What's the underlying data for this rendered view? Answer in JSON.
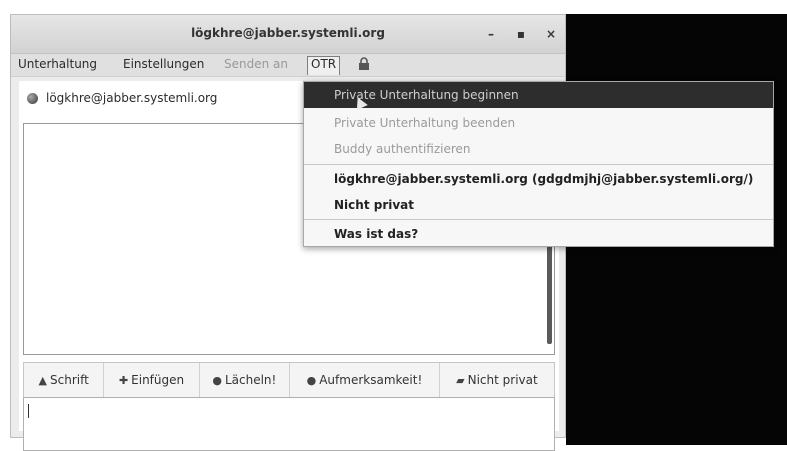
{
  "window": {
    "title": "lögkhre@jabber.systemli.org",
    "minimize_glyph": "–",
    "maximize_glyph": "▪",
    "close_glyph": "×"
  },
  "menubar": {
    "items": [
      "Unterhaltung",
      "Einstellungen",
      "Senden an",
      "OTR"
    ],
    "extra_icon": "lock-icon"
  },
  "contact": {
    "name": "lögkhre@jabber.systemli.org",
    "status_icon": "status-dot-icon"
  },
  "toolbar": {
    "buttons": [
      {
        "label": "Schrift",
        "icon": "font-icon"
      },
      {
        "label": "Einfügen",
        "icon": "insert-icon"
      },
      {
        "label": "Lächeln!",
        "icon": "smiley-icon"
      },
      {
        "label": "Aufmerksamkeit!",
        "icon": "attention-icon"
      },
      {
        "label": "Nicht privat",
        "icon": "unlocked-icon"
      }
    ]
  },
  "otr_menu": {
    "items": [
      {
        "label": "Private Unterhaltung beginnen"
      },
      {
        "label": "Private Unterhaltung beenden"
      },
      {
        "label": "Buddy authentifizieren"
      },
      {
        "label": "lögkhre@jabber.systemli.org (gdgdmjhj@jabber.systemli.org/)"
      },
      {
        "label": "Nicht privat"
      },
      {
        "label": "Was ist das?"
      }
    ]
  },
  "colors": {
    "menu_highlight": "#2d2d2d",
    "background_dark": "#050505"
  }
}
